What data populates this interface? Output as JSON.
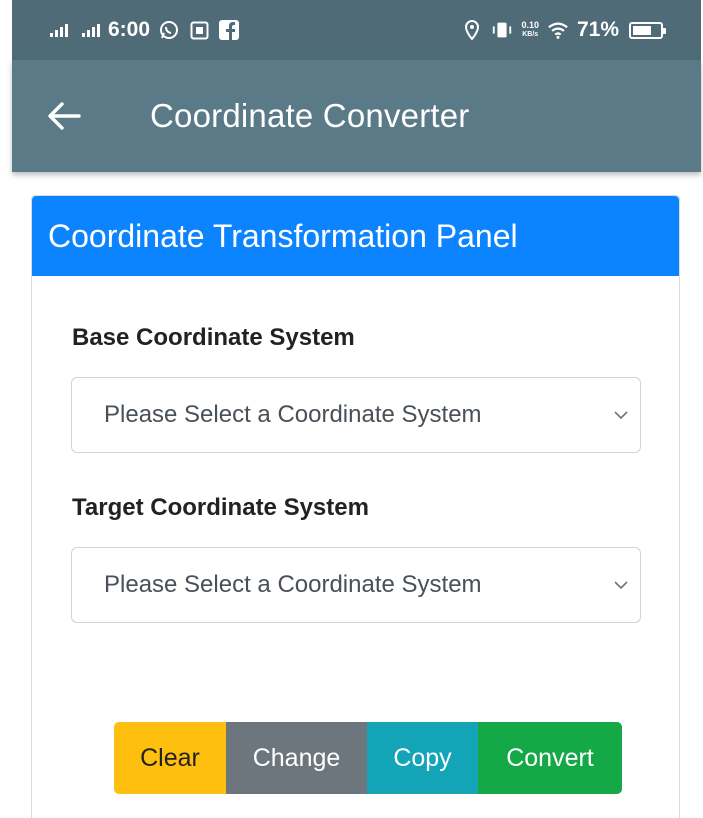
{
  "status_bar": {
    "time": "6:00",
    "network_speed_value": "0.10",
    "network_speed_unit": "KB/s",
    "battery_text": "71%",
    "battery_level": 0.71,
    "icons": [
      "signal-icon",
      "signal-icon",
      "whatsapp-icon",
      "calendar-icon",
      "facebook-icon",
      "location-icon",
      "vibrate-icon",
      "wifi-icon",
      "battery-icon"
    ]
  },
  "app_bar": {
    "title": "Coordinate Converter",
    "back_icon": "back-arrow-icon"
  },
  "panel": {
    "header": "Coordinate Transformation Panel",
    "base_label": "Base Coordinate System",
    "base_select_value": "Please Select a Coordinate System",
    "target_label": "Target Coordinate System",
    "target_select_value": "Please Select a Coordinate System"
  },
  "buttons": {
    "clear": "Clear",
    "change": "Change",
    "copy": "Copy",
    "convert": "Convert"
  },
  "colors": {
    "status_bar": "#4f6b77",
    "app_bar": "#5a7a87",
    "panel_header": "#0d84ff",
    "clear": "#ffbf0f",
    "change": "#6d757d",
    "copy": "#14a4b8",
    "convert": "#14a847"
  }
}
